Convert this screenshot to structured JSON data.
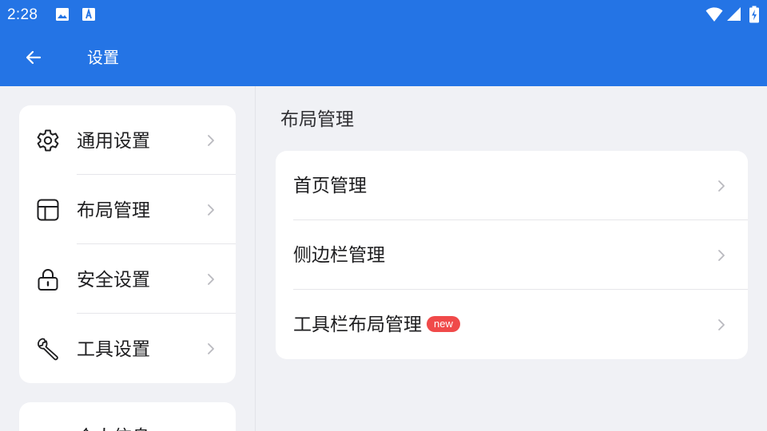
{
  "status_bar": {
    "time": "2:28",
    "icons": [
      "image-icon",
      "font-download-icon",
      "wifi-icon",
      "cellular-signal-icon",
      "battery-charging-icon"
    ]
  },
  "app_bar": {
    "back_icon": "arrow-left-icon",
    "title": "设置"
  },
  "nav": {
    "items": [
      {
        "label": "通用设置",
        "icon": "gear-icon",
        "selected": false
      },
      {
        "label": "布局管理",
        "icon": "layout-icon",
        "selected": true
      },
      {
        "label": "安全设置",
        "icon": "lock-icon",
        "selected": false
      },
      {
        "label": "工具设置",
        "icon": "wrench-icon",
        "selected": false
      }
    ],
    "partial_item_label": "个人信息",
    "chevron_icon": "chevron-right-icon"
  },
  "detail": {
    "section_title": "布局管理",
    "rows": [
      {
        "label": "首页管理",
        "badge": ""
      },
      {
        "label": "侧边栏管理",
        "badge": ""
      },
      {
        "label": "工具栏布局管理",
        "badge": "new"
      }
    ]
  },
  "colors": {
    "primary": "#2474e5",
    "background": "#f0f1f5",
    "card": "#ffffff",
    "badge": "#f04a4a",
    "chevron": "#b9b9bf"
  }
}
